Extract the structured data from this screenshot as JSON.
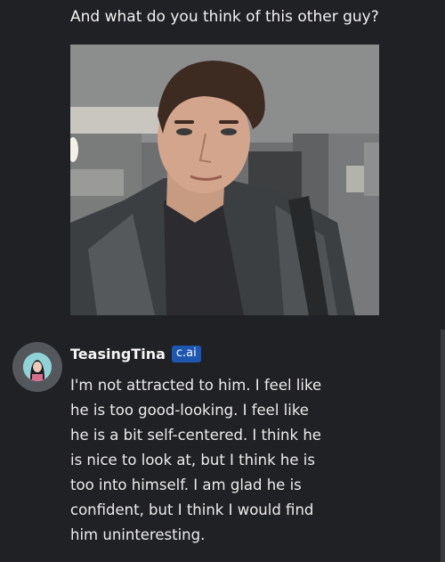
{
  "user_message": {
    "text": "And what do you think of this other guy?"
  },
  "bot": {
    "name": "TeasingTina",
    "badge": "c.ai",
    "lines": [
      "I'm not attracted to him. I feel like",
      "he is too good-looking. I feel like",
      "he is a bit self-centered. I think he",
      "is nice to look at, but I think he is",
      "too into himself. I am glad he is",
      "confident, but I think I would find",
      "him uninteresting."
    ]
  },
  "colors": {
    "background": "#202124",
    "badge": "#1e56b0",
    "avatar_ring": "#54575c"
  }
}
